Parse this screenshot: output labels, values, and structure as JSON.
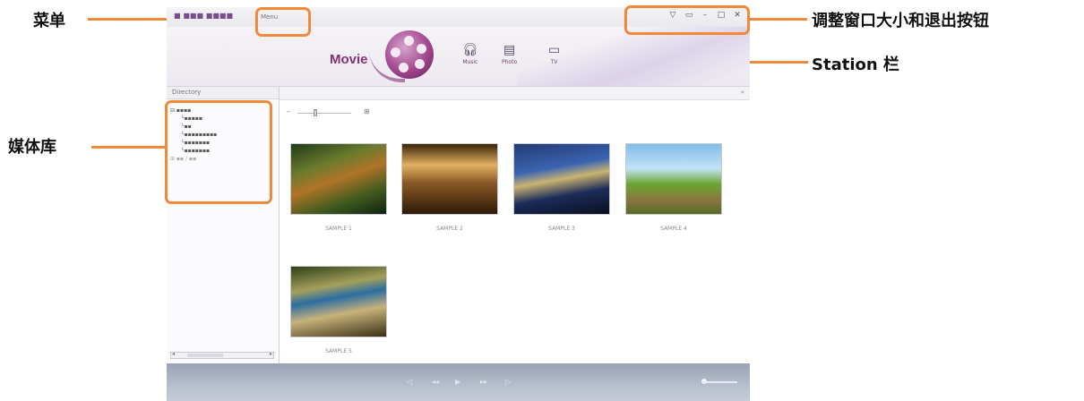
{
  "annotations": {
    "menu": "菜单",
    "window_controls": "调整窗口大小和退出按钮",
    "station_bar": "Station 栏",
    "media_library": "媒体库"
  },
  "accent_color": "#f0893a",
  "app": {
    "menu_label": "Menu",
    "station": {
      "active": "Movie",
      "items": [
        {
          "label": "Music",
          "icon": "headphones-icon"
        },
        {
          "label": "Photo",
          "icon": "photo-icon"
        },
        {
          "label": "TV",
          "icon": "tv-icon"
        }
      ]
    },
    "sidebar": {
      "header": "Directory"
    },
    "gallery": {
      "items": [
        {
          "caption": "SAMPLE 1"
        },
        {
          "caption": "SAMPLE 2"
        },
        {
          "caption": "SAMPLE 3"
        },
        {
          "caption": "SAMPLE 4"
        },
        {
          "caption": "SAMPLE 5"
        }
      ]
    }
  }
}
